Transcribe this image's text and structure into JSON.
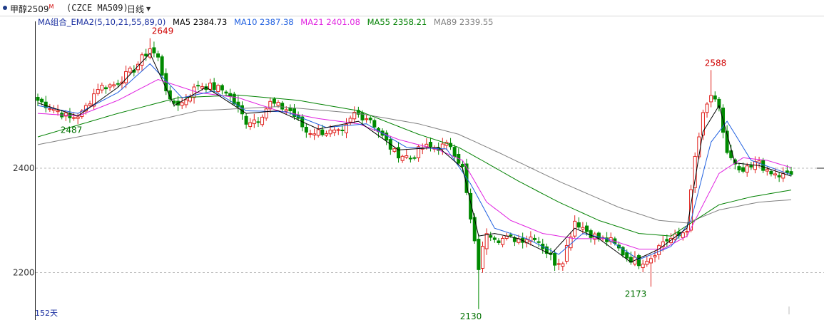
{
  "header": {
    "contract_name": "甲醇2509",
    "contract_superscript": "M",
    "code_info": "(CZCE MA509)",
    "period_label": "日线"
  },
  "indicator_bar": {
    "name": "MA组合_EMA2(5,10,21,55,89,0)",
    "items": [
      {
        "label": "MA5 2384.73",
        "color": "#000000"
      },
      {
        "label": "MA10 2387.38",
        "color": "#2060e0"
      },
      {
        "label": "MA21 2401.08",
        "color": "#e020e0"
      },
      {
        "label": "MA55 2358.21",
        "color": "#008000"
      },
      {
        "label": "MA89 2339.55",
        "color": "#808080"
      }
    ]
  },
  "footer": {
    "day_count": "152天"
  },
  "chart_data": {
    "type": "candlestick",
    "y_ticks": [
      2200,
      2400
    ],
    "ylim": [
      2125,
      2655
    ],
    "grid": "dashed horizontal at tick levels",
    "colors": {
      "up": "#e0201c",
      "down": "#008a00",
      "ma5": "#000000",
      "ma10": "#2060e0",
      "ma21": "#e020e0",
      "ma55": "#008000",
      "ma89": "#808080"
    },
    "annotations": [
      {
        "text": "2649",
        "value": 2649,
        "kind": "high"
      },
      {
        "text": "2487",
        "value": 2487,
        "kind": "low"
      },
      {
        "text": "2130",
        "value": 2130,
        "kind": "low"
      },
      {
        "text": "2588",
        "value": 2588,
        "kind": "high"
      },
      {
        "text": "2173",
        "value": 2173,
        "kind": "low"
      }
    ],
    "close_anchors": [
      [
        0,
        2530
      ],
      [
        5,
        2510
      ],
      [
        8,
        2495
      ],
      [
        11,
        2505
      ],
      [
        15,
        2555
      ],
      [
        19,
        2560
      ],
      [
        24,
        2590
      ],
      [
        28,
        2630
      ],
      [
        30,
        2610
      ],
      [
        33,
        2525
      ],
      [
        36,
        2525
      ],
      [
        40,
        2560
      ],
      [
        44,
        2555
      ],
      [
        47,
        2548
      ],
      [
        52,
        2490
      ],
      [
        55,
        2495
      ],
      [
        58,
        2525
      ],
      [
        63,
        2510
      ],
      [
        67,
        2470
      ],
      [
        72,
        2470
      ],
      [
        76,
        2465
      ],
      [
        79,
        2505
      ],
      [
        83,
        2495
      ],
      [
        86,
        2460
      ],
      [
        89,
        2430
      ],
      [
        93,
        2420
      ],
      [
        96,
        2440
      ],
      [
        100,
        2440
      ],
      [
        103,
        2445
      ],
      [
        106,
        2400
      ],
      [
        108,
        2300
      ],
      [
        110,
        2210
      ],
      [
        112,
        2280
      ],
      [
        115,
        2265
      ],
      [
        118,
        2265
      ],
      [
        121,
        2265
      ],
      [
        124,
        2270
      ],
      [
        127,
        2240
      ],
      [
        129,
        2220
      ],
      [
        131,
        2225
      ],
      [
        134,
        2300
      ],
      [
        137,
        2280
      ],
      [
        140,
        2265
      ],
      [
        143,
        2260
      ],
      [
        147,
        2230
      ],
      [
        150,
        2220
      ],
      [
        153,
        2230
      ],
      [
        156,
        2260
      ],
      [
        158,
        2265
      ],
      [
        160,
        2270
      ],
      [
        162,
        2285
      ],
      [
        164,
        2420
      ],
      [
        166,
        2500
      ],
      [
        168,
        2540
      ],
      [
        170,
        2510
      ],
      [
        172,
        2430
      ],
      [
        175,
        2390
      ],
      [
        178,
        2400
      ],
      [
        180,
        2415
      ],
      [
        182,
        2390
      ],
      [
        185,
        2385
      ],
      [
        188,
        2388
      ]
    ],
    "ma_anchors": {
      "ma5": [
        [
          0,
          2525
        ],
        [
          10,
          2500
        ],
        [
          20,
          2555
        ],
        [
          28,
          2620
        ],
        [
          34,
          2520
        ],
        [
          42,
          2555
        ],
        [
          52,
          2505
        ],
        [
          60,
          2510
        ],
        [
          70,
          2475
        ],
        [
          80,
          2490
        ],
        [
          90,
          2435
        ],
        [
          100,
          2440
        ],
        [
          106,
          2400
        ],
        [
          110,
          2270
        ],
        [
          114,
          2275
        ],
        [
          120,
          2265
        ],
        [
          128,
          2235
        ],
        [
          134,
          2285
        ],
        [
          140,
          2265
        ],
        [
          148,
          2220
        ],
        [
          155,
          2245
        ],
        [
          162,
          2285
        ],
        [
          166,
          2470
        ],
        [
          170,
          2520
        ],
        [
          174,
          2410
        ],
        [
          180,
          2405
        ],
        [
          188,
          2384.73
        ]
      ],
      "ma10": [
        [
          0,
          2520
        ],
        [
          10,
          2505
        ],
        [
          20,
          2545
        ],
        [
          28,
          2600
        ],
        [
          36,
          2535
        ],
        [
          44,
          2548
        ],
        [
          52,
          2510
        ],
        [
          62,
          2508
        ],
        [
          72,
          2478
        ],
        [
          82,
          2485
        ],
        [
          92,
          2440
        ],
        [
          102,
          2437
        ],
        [
          108,
          2370
        ],
        [
          114,
          2285
        ],
        [
          122,
          2265
        ],
        [
          130,
          2235
        ],
        [
          136,
          2275
        ],
        [
          142,
          2265
        ],
        [
          150,
          2225
        ],
        [
          158,
          2250
        ],
        [
          163,
          2300
        ],
        [
          168,
          2450
        ],
        [
          172,
          2490
        ],
        [
          178,
          2415
        ],
        [
          188,
          2387.38
        ]
      ],
      "ma21": [
        [
          0,
          2505
        ],
        [
          10,
          2500
        ],
        [
          20,
          2530
        ],
        [
          30,
          2570
        ],
        [
          40,
          2545
        ],
        [
          50,
          2535
        ],
        [
          60,
          2510
        ],
        [
          70,
          2495
        ],
        [
          80,
          2485
        ],
        [
          90,
          2455
        ],
        [
          100,
          2435
        ],
        [
          106,
          2415
        ],
        [
          112,
          2335
        ],
        [
          118,
          2300
        ],
        [
          126,
          2275
        ],
        [
          134,
          2265
        ],
        [
          142,
          2265
        ],
        [
          150,
          2245
        ],
        [
          156,
          2245
        ],
        [
          162,
          2270
        ],
        [
          166,
          2330
        ],
        [
          170,
          2390
        ],
        [
          176,
          2420
        ],
        [
          182,
          2415
        ],
        [
          188,
          2401.08
        ]
      ],
      "ma55": [
        [
          0,
          2460
        ],
        [
          20,
          2505
        ],
        [
          35,
          2535
        ],
        [
          50,
          2540
        ],
        [
          65,
          2530
        ],
        [
          80,
          2510
        ],
        [
          95,
          2465
        ],
        [
          105,
          2440
        ],
        [
          112,
          2410
        ],
        [
          120,
          2375
        ],
        [
          130,
          2335
        ],
        [
          140,
          2300
        ],
        [
          150,
          2275
        ],
        [
          158,
          2270
        ],
        [
          164,
          2300
        ],
        [
          170,
          2330
        ],
        [
          178,
          2345
        ],
        [
          188,
          2358.21
        ]
      ],
      "ma89": [
        [
          0,
          2445
        ],
        [
          20,
          2475
        ],
        [
          40,
          2510
        ],
        [
          60,
          2518
        ],
        [
          80,
          2505
        ],
        [
          95,
          2485
        ],
        [
          105,
          2465
        ],
        [
          115,
          2430
        ],
        [
          130,
          2375
        ],
        [
          145,
          2325
        ],
        [
          155,
          2300
        ],
        [
          162,
          2295
        ],
        [
          170,
          2320
        ],
        [
          180,
          2335
        ],
        [
          188,
          2339.55
        ]
      ]
    }
  }
}
